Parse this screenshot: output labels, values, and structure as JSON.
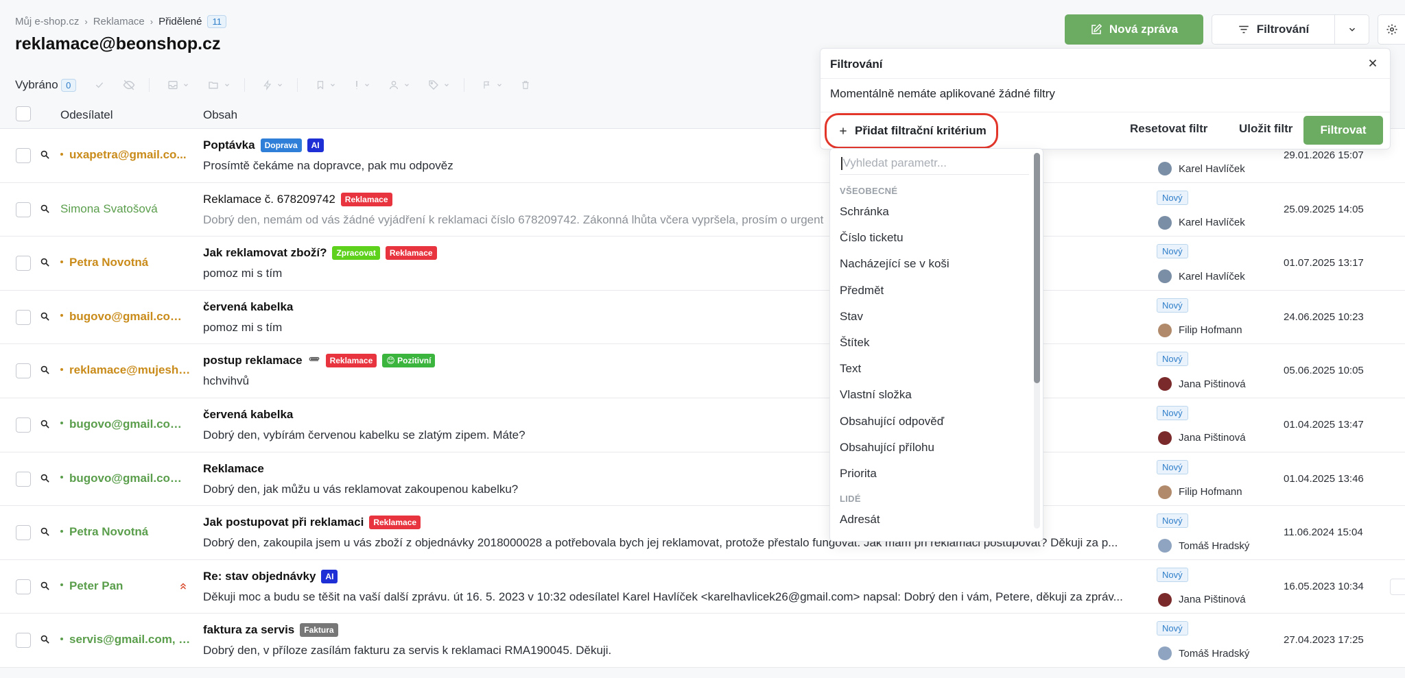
{
  "breadcrumb": {
    "items": [
      "Můj e-shop.cz",
      "Reklamace"
    ],
    "current": "Přidělené",
    "count": "11"
  },
  "page": {
    "title": "reklamace@beonshop.cz"
  },
  "actions": {
    "new_message": "Nová zpráva",
    "filtering": "Filtrování"
  },
  "toolbar": {
    "selected_label": "Vybráno",
    "selected_count": "0"
  },
  "table": {
    "col_sender": "Odesílatel",
    "col_content": "Obsah"
  },
  "colors": {
    "accent_green": "#6cab62",
    "tag_red": "#e8343f",
    "tag_blue": "#2f7ed8",
    "tag_ai": "#1f2fd6",
    "tag_green": "#5dd11c",
    "tag_positive": "#3cb53f",
    "tag_gray": "#777777",
    "sender_orange": "#c98b1a",
    "sender_green": "#5a9e4c"
  },
  "rows": [
    {
      "sender": "uxapetra@gmail.co...",
      "sender_color": "orange",
      "subject": "Poptávka",
      "bold": true,
      "tags": [
        {
          "label": "Doprava",
          "color": "#2f7ed8"
        },
        {
          "label": "AI",
          "color": "#1f2fd6"
        }
      ],
      "preview": "Prosímtě čekáme na dopravce, pak mu odpověz",
      "status": "",
      "assignee": "Karel Havlíček",
      "date": "29.01.2026 15:07"
    },
    {
      "sender": "Simona Svatošová",
      "sender_color": "green-plain",
      "subject": "Reklamace č. 678209742",
      "bold": false,
      "tags": [
        {
          "label": "Reklamace",
          "color": "#e8343f"
        }
      ],
      "preview": "Dobrý den, nemám od vás žádné vyjádření k reklamaci číslo 678209742. Zákonná lhůta včera vypršela, prosím o urgent",
      "muted": true,
      "status": "Nový",
      "assignee": "Karel Havlíček",
      "date": "25.09.2025 14:05"
    },
    {
      "sender": "Petra Novotná",
      "sender_color": "orange",
      "subject": "Jak reklamovat zboží?",
      "bold": true,
      "tags": [
        {
          "label": "Zpracovat",
          "color": "#5dd11c"
        },
        {
          "label": "Reklamace",
          "color": "#e8343f"
        }
      ],
      "preview": "pomoz mi s tím",
      "status": "Nový",
      "assignee": "Karel Havlíček",
      "date": "01.07.2025 13:17"
    },
    {
      "sender": "bugovo@gmail.com, ...",
      "sender_color": "orange",
      "subject": "červená kabelka",
      "bold": true,
      "tags": [],
      "preview": "pomoz mi s tím",
      "status": "Nový",
      "assignee": "Filip Hofmann",
      "date": "24.06.2025 10:23"
    },
    {
      "sender": "reklamace@mujesho...",
      "sender_color": "orange",
      "subject": "postup reklamace",
      "bold": true,
      "attachment": true,
      "tags": [
        {
          "label": "Reklamace",
          "color": "#e8343f"
        },
        {
          "label": "😊 Pozitivní",
          "color": "#3cb53f"
        }
      ],
      "preview": "hchvihvů",
      "status": "Nový",
      "assignee": "Jana Pištinová",
      "date": "05.06.2025 10:05"
    },
    {
      "sender": "bugovo@gmail.com, ...",
      "sender_color": "green",
      "subject": "červená kabelka",
      "bold": true,
      "tags": [],
      "preview": "Dobrý den, vybírám červenou kabelku se zlatým zipem. Máte?",
      "status": "Nový",
      "assignee": "Jana Pištinová",
      "date": "01.04.2025 13:47"
    },
    {
      "sender": "bugovo@gmail.com, ...",
      "sender_color": "green",
      "subject": "Reklamace",
      "bold": true,
      "tags": [],
      "preview": "Dobrý den, jak můžu u vás reklamovat zakoupenou kabelku?",
      "status": "Nový",
      "assignee": "Filip Hofmann",
      "date": "01.04.2025 13:46"
    },
    {
      "sender": "Petra Novotná",
      "sender_color": "green",
      "subject": "Jak postupovat při reklamaci",
      "bold": true,
      "tags": [
        {
          "label": "Reklamace",
          "color": "#e8343f"
        }
      ],
      "preview": "Dobrý den, zakoupila jsem u vás zboží z objednávky 2018000028 a potřebovala bych jej reklamovat, protože přestalo fungovat. Jak mám při reklamaci postupovat? Děkuji za p...",
      "status": "Nový",
      "assignee": "Tomáš Hradský",
      "date": "11.06.2024 15:04"
    },
    {
      "sender": "Peter Pan",
      "sender_color": "green",
      "subject": "Re: stav objednávky",
      "bold": true,
      "priority": true,
      "tags": [
        {
          "label": "AI",
          "color": "#1f2fd6"
        }
      ],
      "preview": "Děkuji moc a budu se těšit na vaší další zprávu. út 16. 5. 2023 v 10:32 odesílatel Karel Havlíček <karelhavlicek26@gmail.com> napsal: Dobrý den i vám, Petere, děkuji za zpráv...",
      "status": "Nový",
      "assignee": "Jana Pištinová",
      "date": "16.05.2023 10:34"
    },
    {
      "sender": "servis@gmail.com, r...",
      "sender_color": "green",
      "subject": "faktura za servis",
      "bold": true,
      "tags": [
        {
          "label": "Faktura",
          "color": "#777777"
        }
      ],
      "preview": "Dobrý den, v příloze zasílám fakturu za servis k reklamaci RMA190045. Děkuji.",
      "status": "Nový",
      "assignee": "Tomáš Hradský",
      "date": "27.04.2023 17:25"
    }
  ],
  "filter": {
    "title": "Filtrování",
    "message": "Momentálně nemáte aplikované žádné filtry",
    "add_criterion": "Přidat filtrační kritérium",
    "reset": "Resetovat filtr",
    "save": "Uložit filtr",
    "submit": "Filtrovat"
  },
  "dropdown": {
    "search_placeholder": "Vyhledat parametr...",
    "groups": [
      {
        "label": "VŠEOBECNÉ",
        "items": [
          "Schránka",
          "Číslo ticketu",
          "Nacházející se v koši",
          "Předmět",
          "Stav",
          "Štítek",
          "Text",
          "Vlastní složka",
          "Obsahující odpověď",
          "Obsahující přílohu",
          "Priorita"
        ]
      },
      {
        "label": "LIDÉ",
        "items": [
          "Adresát"
        ]
      }
    ]
  }
}
